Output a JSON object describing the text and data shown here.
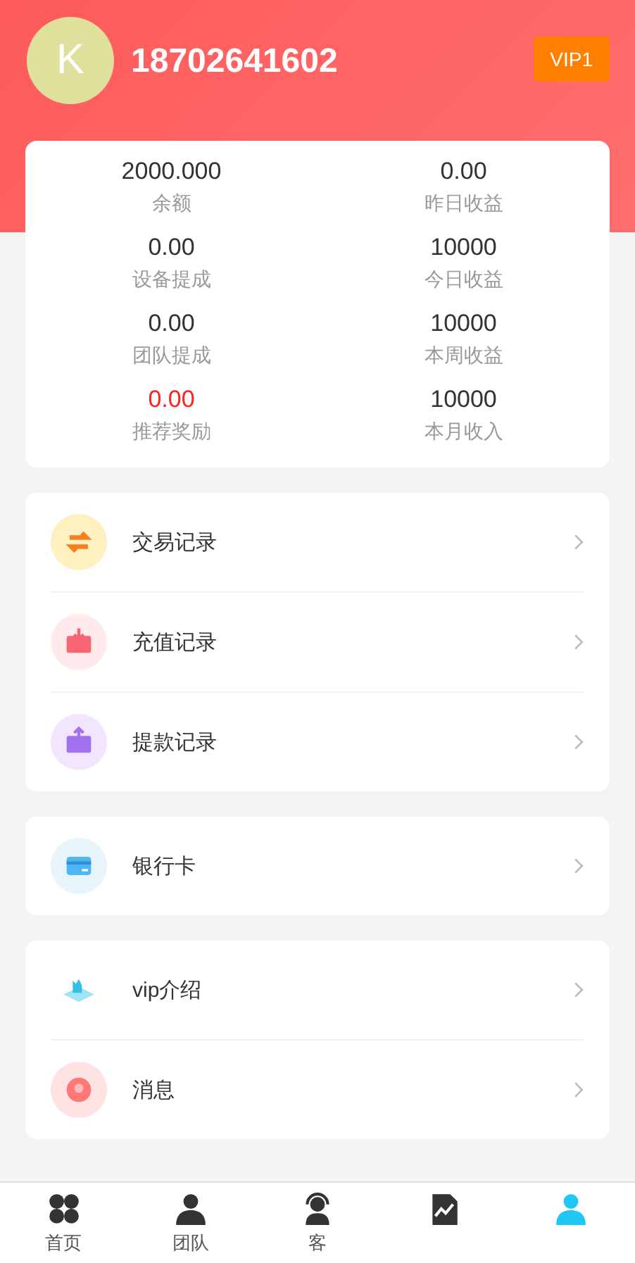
{
  "profile": {
    "avatar_letter": "K",
    "phone": "18702641602",
    "vip_badge": "VIP1"
  },
  "stats": [
    {
      "value": "2000.000",
      "label": "余额",
      "highlight": false
    },
    {
      "value": "0.00",
      "label": "昨日收益",
      "highlight": false
    },
    {
      "value": "0.00",
      "label": "设备提成",
      "highlight": false
    },
    {
      "value": "10000",
      "label": "今日收益",
      "highlight": false
    },
    {
      "value": "0.00",
      "label": "团队提成",
      "highlight": false
    },
    {
      "value": "10000",
      "label": "本周收益",
      "highlight": false
    },
    {
      "value": "0.00",
      "label": "推荐奖励",
      "highlight": true
    },
    {
      "value": "10000",
      "label": "本月收入",
      "highlight": false
    }
  ],
  "menu_groups": [
    [
      {
        "label": "交易记录",
        "kind": "exchange"
      },
      {
        "label": "充值记录",
        "kind": "deposit"
      },
      {
        "label": "提款记录",
        "kind": "withdraw"
      }
    ],
    [
      {
        "label": "银行卡",
        "kind": "card"
      }
    ],
    [
      {
        "label": "vip介绍",
        "kind": "vip"
      },
      {
        "label": "消息",
        "kind": "message"
      }
    ]
  ],
  "tab_bar": [
    {
      "label": "首页",
      "kind": "home",
      "selected": false
    },
    {
      "label": "团队",
      "kind": "team",
      "selected": false
    },
    {
      "label": "客",
      "kind": "service",
      "selected": false
    },
    {
      "kind": "chart",
      "selected": false
    },
    {
      "kind": "user",
      "selected": true
    }
  ]
}
